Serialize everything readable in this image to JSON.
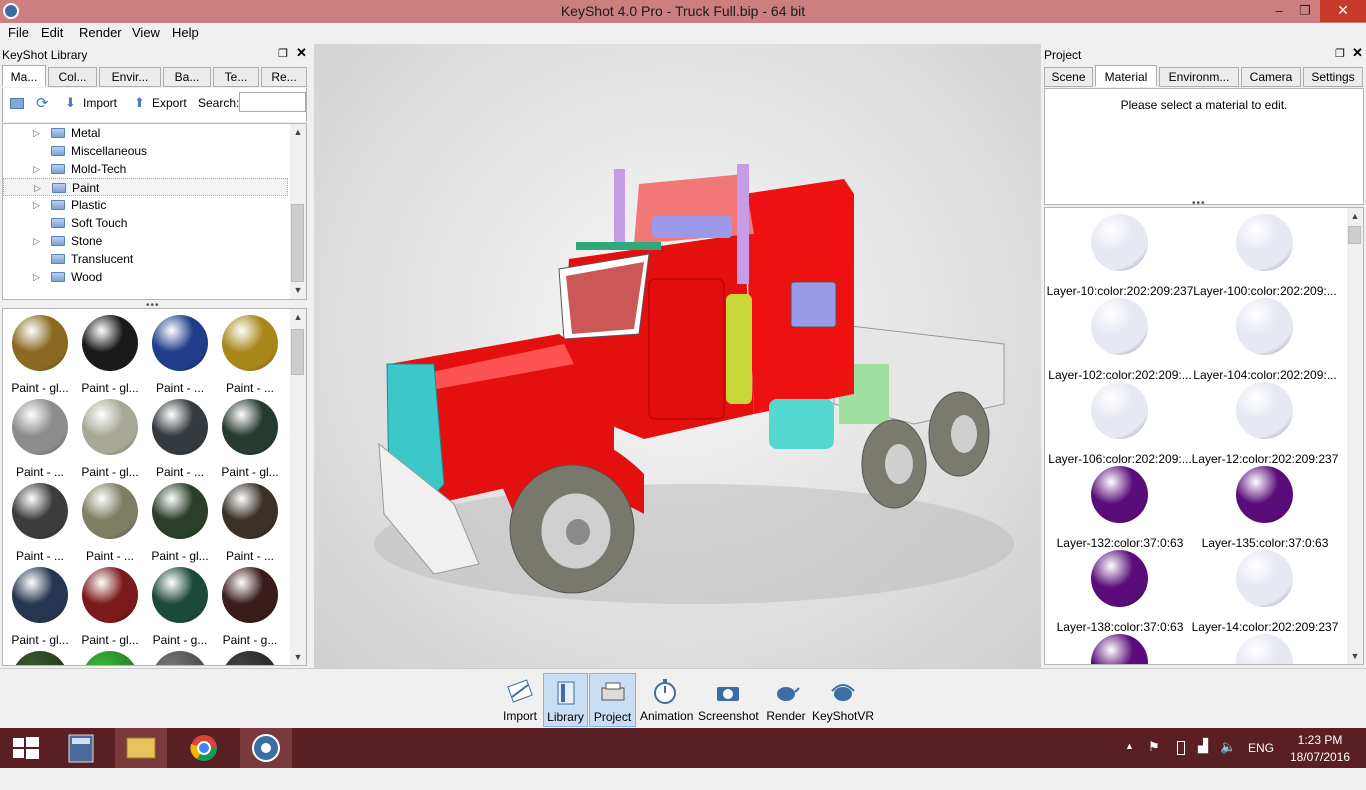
{
  "window": {
    "title": "KeyShot 4.0 Pro  - Truck Full.bip  - 64 bit",
    "minimize": "–",
    "maximize": "❐",
    "close": "✕"
  },
  "menu": [
    "File",
    "Edit",
    "Render",
    "View",
    "Help"
  ],
  "library": {
    "title": "KeyShot Library",
    "tabs": [
      "Ma...",
      "Col...",
      "Envir...",
      "Ba...",
      "Te...",
      "Re..."
    ],
    "import": "Import",
    "export": "Export",
    "search_label": "Search:",
    "search_value": "",
    "tree": [
      "Metal",
      "Miscellaneous",
      "Mold-Tech",
      "Paint",
      "Plastic",
      "Soft Touch",
      "Stone",
      "Translucent",
      "Wood"
    ],
    "swatches": [
      {
        "label": "Paint - gl...",
        "color": "#8a6a20"
      },
      {
        "label": "Paint - gl...",
        "color": "#1a1a1a"
      },
      {
        "label": "Paint - ...",
        "color": "#1f3d8a"
      },
      {
        "label": "Paint - ...",
        "color": "#a8871a"
      },
      {
        "label": "Paint - ...",
        "color": "#8c8c8c"
      },
      {
        "label": "Paint - gl...",
        "color": "#a8a896"
      },
      {
        "label": "Paint - ...",
        "color": "#353a3e"
      },
      {
        "label": "Paint - gl...",
        "color": "#263a30"
      },
      {
        "label": "Paint - ...",
        "color": "#3c3c3c"
      },
      {
        "label": "Paint - ...",
        "color": "#7e7e62"
      },
      {
        "label": "Paint - gl...",
        "color": "#2b3d2b"
      },
      {
        "label": "Paint - ...",
        "color": "#3a3128"
      },
      {
        "label": "Paint - gl...",
        "color": "#263650"
      },
      {
        "label": "Paint - gl...",
        "color": "#7a1a1a"
      },
      {
        "label": "Paint - g...",
        "color": "#1c4a3a"
      },
      {
        "label": "Paint - g...",
        "color": "#3a1c1c"
      }
    ]
  },
  "project": {
    "title": "Project",
    "tabs": [
      "Scene",
      "Material",
      "Environm...",
      "Camera",
      "Settings"
    ],
    "message": "Please select a material to edit.",
    "materials": [
      {
        "label": "Layer-10:color:202:209:237",
        "color": "#e6e8f2"
      },
      {
        "label": "Layer-100:color:202:209:...",
        "color": "#e6e8f2"
      },
      {
        "label": "Layer-102:color:202:209:...",
        "color": "#e6e8f2"
      },
      {
        "label": "Layer-104:color:202:209:...",
        "color": "#e6e8f2"
      },
      {
        "label": "Layer-106:color:202:209:...",
        "color": "#e6e8f2"
      },
      {
        "label": "Layer-12:color:202:209:237",
        "color": "#e6e8f2"
      },
      {
        "label": "Layer-132:color:37:0:63",
        "color": "#5a0d7a"
      },
      {
        "label": "Layer-135:color:37:0:63",
        "color": "#5a0d7a"
      },
      {
        "label": "Layer-138:color:37:0:63",
        "color": "#5a0d7a"
      },
      {
        "label": "Layer-14:color:202:209:237",
        "color": "#e6e8f2"
      }
    ]
  },
  "toolbar": [
    "Import",
    "Library",
    "Project",
    "Animation",
    "Screenshot",
    "Render",
    "KeyShotVR"
  ],
  "taskbar": {
    "lang": "ENG",
    "time": "1:23 PM",
    "date": "18/07/2016"
  }
}
